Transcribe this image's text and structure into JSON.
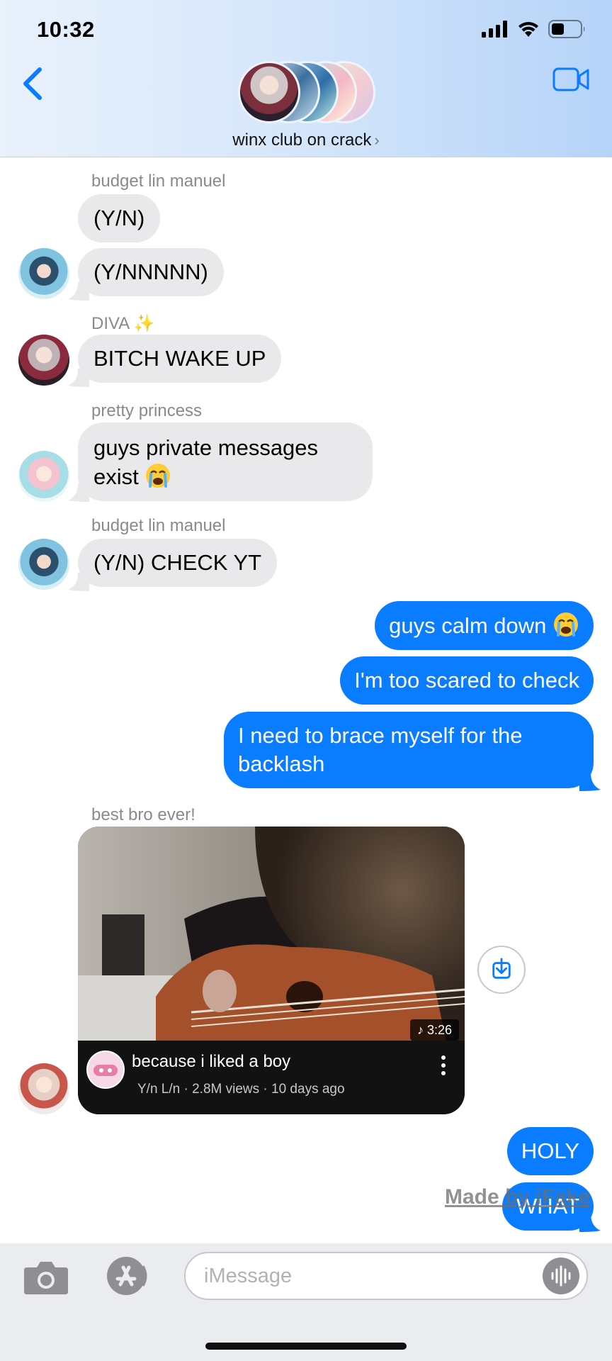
{
  "status_bar": {
    "time": "10:32"
  },
  "header": {
    "group_name": "winx club on crack",
    "chevron": "›",
    "icons": [
      "back-chevron-icon",
      "video-camera-icon"
    ]
  },
  "messages": [
    {
      "sender": "budget lin manuel",
      "text": "(Y/N)",
      "direction": "incoming"
    },
    {
      "sender": "",
      "text": "(Y/NNNNN)",
      "direction": "incoming"
    },
    {
      "sender": "DIVA ✨",
      "text": "BITCH WAKE UP",
      "direction": "incoming"
    },
    {
      "sender": "pretty princess",
      "text_line1": "guys private messages",
      "text_line2": "exist",
      "emoji": "loudly-crying-face",
      "direction": "incoming"
    },
    {
      "sender": "budget lin manuel",
      "text": "(Y/N) CHECK YT",
      "direction": "incoming"
    },
    {
      "text": "guys calm down",
      "emoji": "loudly-crying-face",
      "direction": "outgoing"
    },
    {
      "text": "I'm too scared to check",
      "direction": "outgoing"
    },
    {
      "text_line1": "I need to brace myself for the",
      "text_line2": "backlash",
      "direction": "outgoing"
    },
    {
      "sender": "best bro ever!",
      "type": "youtube-link",
      "direction": "incoming"
    },
    {
      "text": "HOLY",
      "direction": "outgoing"
    },
    {
      "text": "WHAT",
      "direction": "outgoing"
    }
  ],
  "youtube": {
    "title": "because i liked a boy",
    "channel": "Y/n L/n",
    "meta": "· 2.8M views · 10 days ago",
    "duration": "3:26"
  },
  "watermark": "Made by iFake",
  "composer": {
    "placeholder": "iMessage",
    "icons": [
      "camera-icon",
      "app-store-icon",
      "audio-waveform-icon"
    ]
  },
  "colors": {
    "outgoing_bubble": "#0a7cff",
    "incoming_bubble": "#e9e9eb",
    "header_gradient_end": "#b5d3f8"
  }
}
